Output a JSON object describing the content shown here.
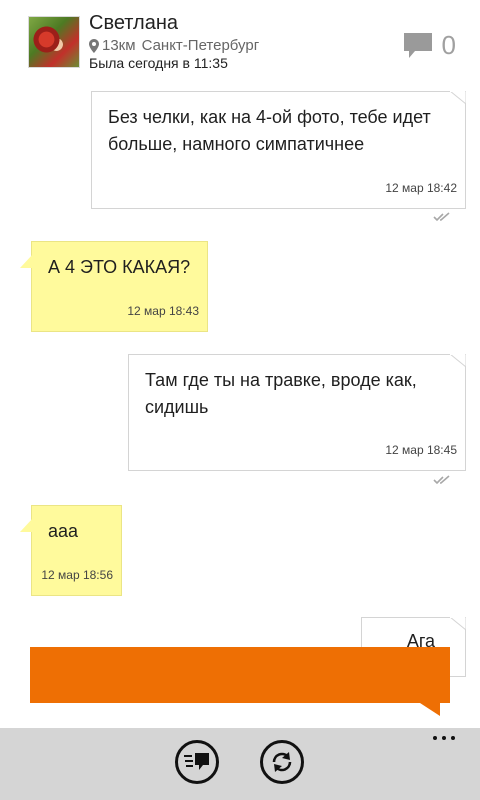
{
  "contact": {
    "name": "Светлана",
    "distance": "13км",
    "city": "Санкт-Петербург",
    "last_seen": "Была сегодня в 11:35",
    "message_count": "0"
  },
  "messages": [
    {
      "direction": "out",
      "text": "Без челки, как на 4-ой фото, тебе идет больше, намного симпатичнее",
      "time": "12 мар 18:42",
      "status": "read"
    },
    {
      "direction": "in",
      "text": "А 4 ЭТО КАКАЯ?",
      "time": "12 мар 18:43"
    },
    {
      "direction": "out",
      "text": "Там где ты на травке, вроде как, сидишь",
      "time": "12 мар 18:45",
      "status": "read"
    },
    {
      "direction": "in",
      "text": "ааа",
      "time": "12 мар 18:56"
    },
    {
      "direction": "out",
      "text": "Ага"
    }
  ],
  "colors": {
    "accent": "#ee6f04",
    "incoming_bubble": "#fffa9c",
    "outgoing_bubble": "#ffffff",
    "app_bar": "#d5d5d5"
  },
  "icons": {
    "location": "map-pin-icon",
    "messages": "speech-bubble-icon",
    "read_status": "double-check-icon",
    "chats": "chat-list-icon",
    "refresh": "refresh-icon",
    "more": "more-dots-icon"
  }
}
